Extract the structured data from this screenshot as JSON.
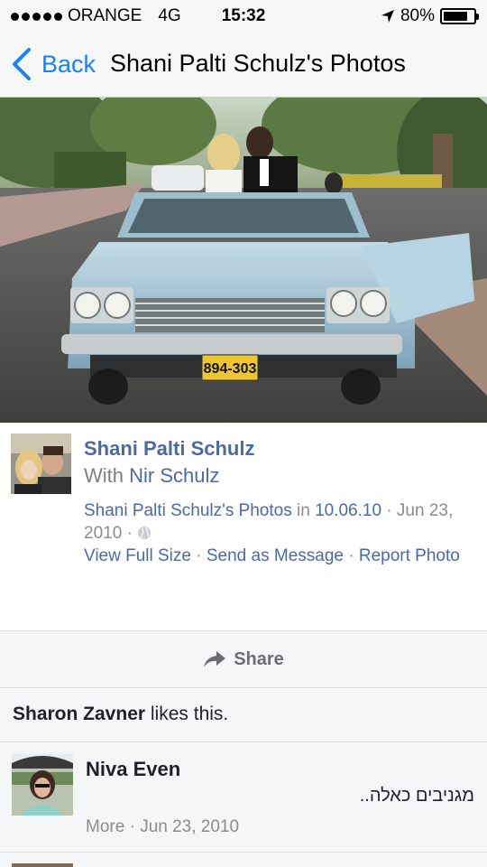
{
  "status_bar": {
    "carrier": "ORANGE",
    "network": "4G",
    "time": "15:32",
    "battery_text": "80%",
    "battery_level": 0.8
  },
  "nav": {
    "back_label": "Back",
    "title": "Shani Palti Schulz's Photos"
  },
  "post": {
    "author": "Shani Palti Schulz",
    "with_prefix": "With",
    "with_name": "Nir Schulz",
    "album_link": "Shani Palti Schulz's Photos",
    "in_word": "in",
    "album_name": "10.06.10",
    "date": "Jun 23, 2010",
    "privacy_icon": "globe-icon",
    "plate": "894-303",
    "actions": {
      "view_full_size": "View Full Size",
      "send_as_message": "Send as Message",
      "report_photo": "Report Photo"
    }
  },
  "share": {
    "label": "Share",
    "icon": "share-arrow-icon"
  },
  "likes": {
    "name": "Sharon Zavner",
    "suffix": "likes this."
  },
  "comments": [
    {
      "name": "Niva Even",
      "text": "מגניבים כאלה..",
      "more": "More",
      "date": "Jun 23, 2010"
    }
  ],
  "colors": {
    "link": "#4b6aa3",
    "ios_blue": "#1a82fb",
    "muted": "#8c8c8c",
    "panel_bg": "#f5f6f8"
  }
}
